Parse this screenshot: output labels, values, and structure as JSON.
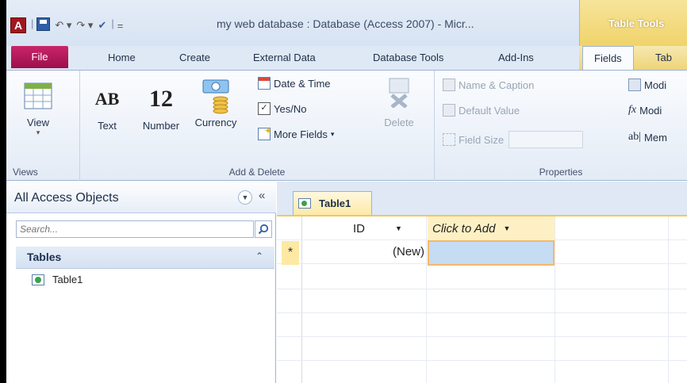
{
  "window": {
    "title": "my web database : Database (Access 2007)  -  Micr...",
    "contextual_tab_group": "Table Tools"
  },
  "qat": {
    "app_icon": "A",
    "separator": "|",
    "customize": "="
  },
  "tabs": {
    "file": "File",
    "items": [
      "Home",
      "Create",
      "External Data",
      "Database Tools",
      "Add-Ins",
      "Fields",
      "Tab"
    ],
    "active": "Fields"
  },
  "ribbon": {
    "views": {
      "view_label": "View",
      "group_label": "Views"
    },
    "add_delete": {
      "text_label": "Text",
      "text_glyph": "AB",
      "number_label": "Number",
      "number_glyph": "12",
      "currency_label": "Currency",
      "date_time": "Date & Time",
      "yes_no": "Yes/No",
      "more_fields": "More Fields",
      "delete_label": "Delete",
      "group_label": "Add & Delete"
    },
    "properties": {
      "name_caption": "Name & Caption",
      "default_value": "Default Value",
      "field_size": "Field Size",
      "modify1": "Modi",
      "modify2": "Modi",
      "memo": "Mem",
      "group_label": "Properties"
    }
  },
  "nav": {
    "title": "All Access Objects",
    "collapse_glyph": "«",
    "search_placeholder": "Search...",
    "group": "Tables",
    "group_chev": "≈",
    "items": [
      "Table1"
    ]
  },
  "datasheet": {
    "tab_label": "Table1",
    "columns": [
      "ID",
      "Click to Add"
    ],
    "new_row_marker": "*",
    "new_row_value": "(New)"
  },
  "colors": {
    "file_tab": "#b31a5c",
    "contextual": "#f0d36a",
    "selection": "#c5dcf3"
  }
}
